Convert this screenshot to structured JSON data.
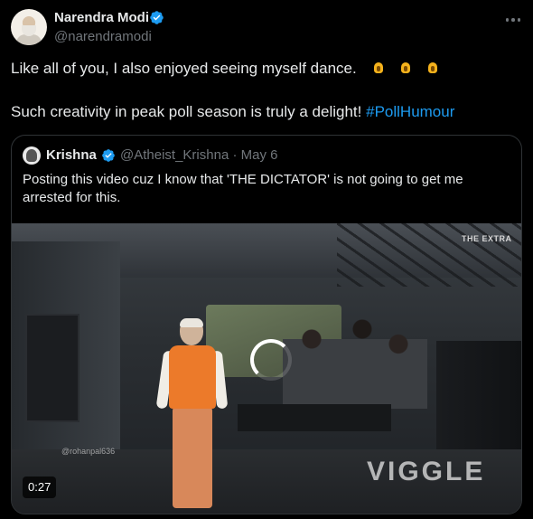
{
  "tweet": {
    "author_name": "Narendra Modi",
    "author_handle": "@narendramodi",
    "line1": "Like all of you, I also enjoyed seeing myself dance.",
    "line1_emojis": [
      "clapping-hands-emoji",
      "clapping-hands-emoji",
      "clapping-hands-emoji"
    ],
    "line2_text": "Such creativity in peak poll season is truly a delight!",
    "hashtag": "#PollHumour"
  },
  "quoted": {
    "author_name": "Krishna",
    "author_handle": "@Atheist_Krishna",
    "separator": "·",
    "date": "May 6",
    "text": "Posting this video cuz I know that 'THE DICTATOR' is not going to get me arrested for this.",
    "video": {
      "duration": "0:27",
      "watermark_handle": "@rohanpal636",
      "watermark_top": "THE EXTRA",
      "watermark_brand": "VIGGLE"
    }
  },
  "colors": {
    "background": "#000000",
    "text": "#e7e9ea",
    "muted": "#71767b",
    "link": "#1d9bf0",
    "border": "#2f3336",
    "verified": "#1d9bf0"
  }
}
